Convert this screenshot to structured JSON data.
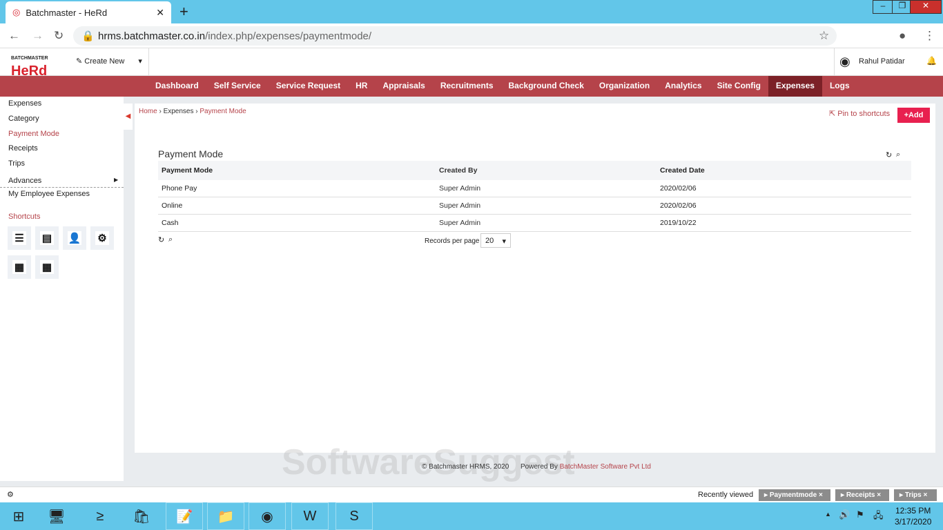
{
  "browser": {
    "tab_title": "Batchmaster - HeRd",
    "url_host": "hrms.batchmaster.co.in",
    "url_path": "/index.php/expenses/paymentmode/"
  },
  "app": {
    "logo_top": "BATCHMASTER",
    "logo": "HeRd",
    "create_new": "Create New",
    "user": "Rahul Patidar"
  },
  "nav": [
    "Dashboard",
    "Self Service",
    "Service Request",
    "HR",
    "Appraisals",
    "Recruitments",
    "Background Check",
    "Organization",
    "Analytics",
    "Site Config",
    "Expenses",
    "Logs"
  ],
  "sidebar": {
    "items": [
      "Expenses",
      "Category",
      "Payment Mode",
      "Receipts",
      "Trips",
      "Advances",
      "My Employee Expenses"
    ],
    "shortcuts_label": "Shortcuts"
  },
  "breadcrumb": [
    "Home",
    "Expenses",
    "Payment Mode"
  ],
  "actions": {
    "pin": "Pin to shortcuts",
    "add": "+Add"
  },
  "page_title": "Payment Mode",
  "table": {
    "headers": [
      "Payment Mode",
      "Created By",
      "Created Date"
    ],
    "rows": [
      [
        "Phone Pay",
        "Super Admin",
        "2020/02/06"
      ],
      [
        "Online",
        "Super Admin",
        "2020/02/06"
      ],
      [
        "Cash",
        "Super Admin",
        "2019/10/22"
      ]
    ]
  },
  "pager": {
    "label": "Records per page",
    "value": "20"
  },
  "footer": {
    "copyright": "© Batchmaster HRMS, 2020",
    "powered": "Powered By",
    "company": "BatchMaster Software Pvt Ltd"
  },
  "watermark": "SoftwareSuggest.com",
  "recent": {
    "label": "Recently viewed",
    "items": [
      "Paymentmode",
      "Receipts",
      "Trips"
    ]
  },
  "clock": {
    "time": "12:35 PM",
    "date": "3/17/2020"
  }
}
